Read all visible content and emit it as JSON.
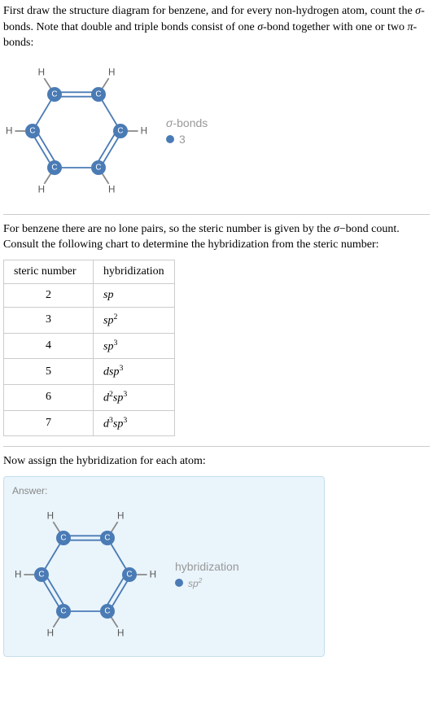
{
  "intro": {
    "p1a": "First draw the structure diagram for benzene, and for every non-hydrogen atom, count the ",
    "sigma": "σ",
    "p1b": "-bonds. Note that double and triple bonds consist of one ",
    "p1c": "-bond together with one or two ",
    "pi": "π",
    "p1d": "-bonds:"
  },
  "sigma_legend": {
    "title_a": "σ",
    "title_b": "-bonds",
    "value": "3"
  },
  "section2": {
    "p2a": "For benzene there are no lone pairs, so the steric number is given by the ",
    "sigma": "σ",
    "p2b": "−bond count. Consult the following chart to determine the hybridization from the steric number:"
  },
  "table": {
    "h1": "steric number",
    "h2": "hybridization",
    "rows": [
      {
        "n": "2",
        "h": "sp"
      },
      {
        "n": "3",
        "h": "sp",
        "sup": "2"
      },
      {
        "n": "4",
        "h": "sp",
        "sup": "3"
      },
      {
        "n": "5",
        "h": "dsp",
        "sup": "3"
      },
      {
        "n": "6",
        "h": "d",
        "presup": "2",
        "h2": "sp",
        "sup": "3"
      },
      {
        "n": "7",
        "h": "d",
        "presup": "3",
        "h2": "sp",
        "sup": "3"
      }
    ]
  },
  "section3": {
    "text": "Now assign the hybridization for each atom:"
  },
  "answer": {
    "label": "Answer:",
    "legend_title": "hybridization",
    "legend_val_base": "sp",
    "legend_val_sup": "2"
  },
  "atoms": {
    "C": "C",
    "H": "H"
  }
}
